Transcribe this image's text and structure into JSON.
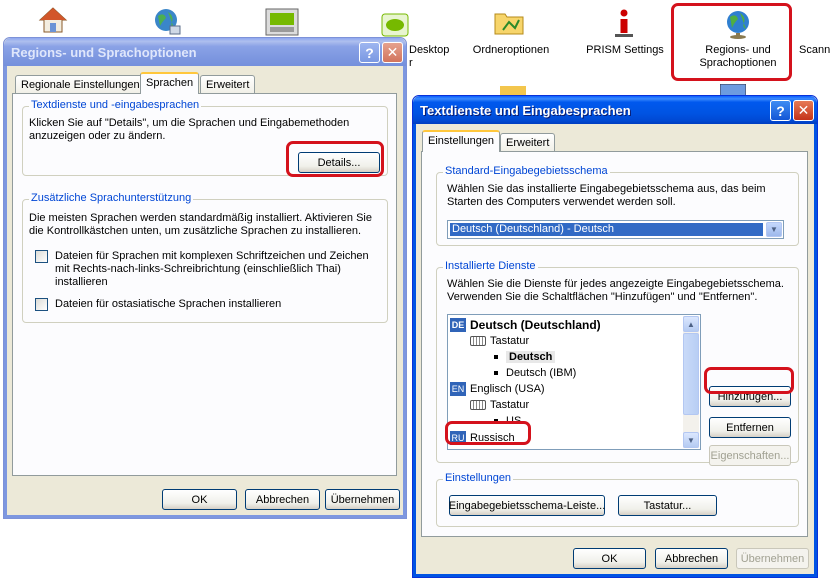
{
  "desktop": {
    "items": [
      {
        "icon": "house-icon",
        "label": ""
      },
      {
        "icon": "globe-network-icon",
        "label": ""
      },
      {
        "icon": "nvidia-card-icon",
        "label": ""
      },
      {
        "icon": "nvidia-icon",
        "label": "Desktop"
      },
      {
        "icon": "folder-options-icon",
        "label": "Ordneroptionen"
      },
      {
        "icon": "info-icon",
        "label": "PRISM Settings"
      },
      {
        "icon": "globe-icon",
        "label": "Regions- und\nSprachoptionen"
      },
      {
        "icon": "scanner-icon",
        "label": "Scann"
      }
    ],
    "fragment_r": "r"
  },
  "window1": {
    "title": "Regions- und Sprachoptionen",
    "tabs": [
      "Regionale Einstellungen",
      "Sprachen",
      "Erweitert"
    ],
    "selected_tab": "Sprachen",
    "group1": {
      "legend": "Textdienste und -eingabesprachen",
      "text": "Klicken Sie auf \"Details\", um die Sprachen und Eingabemethoden anzuzeigen oder zu ändern.",
      "details_button": "Details..."
    },
    "group2": {
      "legend": "Zusätzliche Sprachunterstützung",
      "text": "Die meisten Sprachen werden standardmäßig installiert. Aktivieren Sie die Kontrollkästchen unten, um zusätzliche Sprachen zu installieren.",
      "checkbox1": "Dateien für Sprachen mit komplexen Schriftzeichen und Zeichen mit Rechts-nach-links-Schreibrichtung (einschließlich Thai) installieren",
      "checkbox2": "Dateien für ostasiatische Sprachen installieren"
    },
    "buttons": {
      "ok": "OK",
      "cancel": "Abbrechen",
      "apply": "Übernehmen"
    }
  },
  "window2": {
    "title": "Textdienste und Eingabesprachen",
    "tabs": [
      "Einstellungen",
      "Erweitert"
    ],
    "selected_tab": "Einstellungen",
    "default_group": {
      "legend": "Standard-Eingabegebietsschema",
      "text": "Wählen Sie das installierte Eingabegebietsschema aus, das beim Starten des Computers verwendet werden soll.",
      "combo_value": "Deutsch (Deutschland) - Deutsch"
    },
    "installed_group": {
      "legend": "Installierte Dienste",
      "text": "Wählen Sie die Dienste für jedes angezeigte Eingabegebietsschema. Verwenden Sie die Schaltflächen \"Hinzufügen\" und \"Entfernen\".",
      "tree": [
        {
          "badge": "DE",
          "label": "Deutsch (Deutschland)"
        },
        {
          "label": "Tastatur"
        },
        {
          "label": "Deutsch"
        },
        {
          "label": "Deutsch (IBM)"
        },
        {
          "badge": "EN",
          "label": "Englisch (USA)"
        },
        {
          "label": "Tastatur"
        },
        {
          "label": "US"
        },
        {
          "badge": "RU",
          "label": "Russisch"
        }
      ],
      "add_button": "Hinzufügen...",
      "remove_button": "Entfernen",
      "properties_button": "Eigenschaften..."
    },
    "settings_group": {
      "legend": "Einstellungen",
      "langbar_button": "Eingabegebietsschema-Leiste...",
      "keyboard_button": "Tastatur..."
    },
    "buttons": {
      "ok": "OK",
      "cancel": "Abbrechen",
      "apply": "Übernehmen"
    }
  },
  "colors": {
    "highlight": "#d4121c",
    "xp_blue": "#0054e3",
    "selection": "#316ac5"
  }
}
